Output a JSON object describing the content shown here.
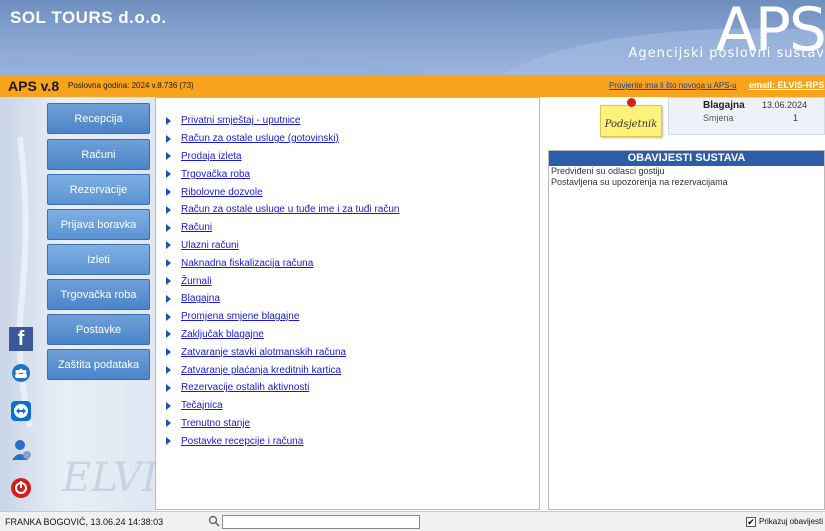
{
  "header": {
    "company": "SOL TOURS d.o.o.",
    "brand": "APS",
    "brand_subtitle": "Agencijski poslovni sustav"
  },
  "topbar": {
    "version": "APS v.8",
    "version_info": "Poslovna godina: 2024 v.8.736 (73)",
    "check_link": "Provjerite ima li što novoga u APS-u",
    "email_link": "email: ELVIS-RPS"
  },
  "sidebar": {
    "items": [
      {
        "label": "Recepcija"
      },
      {
        "label": "Računi"
      },
      {
        "label": "Rezervacije"
      },
      {
        "label": "Prijava boravka"
      },
      {
        "label": "Izleti"
      },
      {
        "label": "Trgovačka roba"
      },
      {
        "label": "Postavke"
      },
      {
        "label": "Zaštita podataka"
      }
    ],
    "watermark": "ELVIS",
    "social_icons": [
      "facebook-icon",
      "group-icon",
      "teamviewer-icon",
      "user-settings-icon",
      "power-icon"
    ]
  },
  "menu": {
    "items": [
      "Privatni smještaj - uputnice",
      "Račun za ostale usluge (gotovinski)",
      "Prodaja izleta",
      "Trgovačka roba",
      "Ribolovne dozvole",
      "Račun za ostale usluge u tuđe ime i za tuđi račun",
      "Računi",
      "Ulazni računi",
      "Naknadna fiskalizacija računa",
      "Žurnali",
      "Blagajna",
      "Promjena smjene blagajne",
      "Zaključak blagajne",
      "Zatvaranje stavki alotmanskih računa",
      "Zatvaranje plaćanja kreditnih kartica",
      "Rezervacije ostalih aktivnosti",
      "Tečajnica",
      "Trenutno stanje",
      "Postavke recepcije i računa"
    ]
  },
  "reminder": {
    "label": "Podsjetnik"
  },
  "cashbox": {
    "label": "Blagajna",
    "date": "13.06.2024",
    "shift_label": "Smjena",
    "shift_value": "1"
  },
  "notices": {
    "title": "OBAVIJESTI SUSTAVA",
    "lines": [
      "Predviđeni su odlasci gostiju",
      "Postavljena su upozorenja na rezervacijama"
    ]
  },
  "status": {
    "user": "FRANKA BOGOVIĆ, 13.06.24 14:38:03",
    "search_value": "",
    "show_notices_label": "Prikazuj obavijesti",
    "show_notices_checked": "✔"
  }
}
